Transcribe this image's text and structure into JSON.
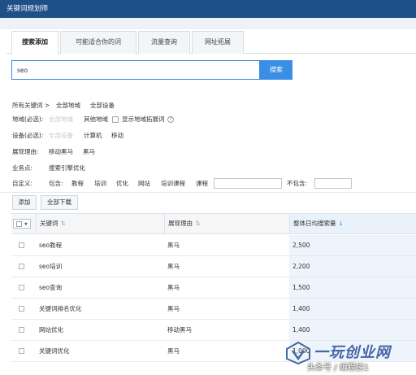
{
  "app": {
    "title": "关键词规划师"
  },
  "tabs": [
    {
      "label": "搜索添加",
      "active": true
    },
    {
      "label": "可能适合你的词",
      "active": false
    },
    {
      "label": "流量查询",
      "active": false
    },
    {
      "label": "网址拓展",
      "active": false
    }
  ],
  "search": {
    "value": "seo",
    "button": "搜索"
  },
  "breadcrumb": {
    "root": "所有关键词 >",
    "region": "全部地域",
    "device": "全部设备"
  },
  "region": {
    "label": "地域(必选):",
    "all": "全部地域",
    "other": "其他地域",
    "show_label": "显示地域拓展词"
  },
  "device": {
    "label": "设备(必选):",
    "all": "全部设备",
    "pc": "计算机",
    "mobile": "移动"
  },
  "reason": {
    "label": "展现理由:",
    "items": [
      "移动黑马",
      "黑马"
    ]
  },
  "business": {
    "label": "业务点:",
    "value": "搜索引擎优化"
  },
  "custom": {
    "label": "自定义:",
    "include_label": "包含:",
    "include_items": [
      "教程",
      "培训",
      "优化",
      "网站",
      "培训课程",
      "课程"
    ],
    "exclude_label": "不包含:"
  },
  "actions": {
    "add": "添加",
    "download_all": "全部下载"
  },
  "table": {
    "headers": {
      "keyword": "关键词",
      "reason": "展现理由",
      "volume": "整体日均搜索量"
    },
    "rows": [
      {
        "keyword": "seo教程",
        "reason": "黑马",
        "volume": "2,500"
      },
      {
        "keyword": "seo培训",
        "reason": "黑马",
        "volume": "2,200"
      },
      {
        "keyword": "seo查询",
        "reason": "黑马",
        "volume": "1,500"
      },
      {
        "keyword": "关键词排名优化",
        "reason": "黑马",
        "volume": "1,400"
      },
      {
        "keyword": "网站优化",
        "reason": "移动黑马",
        "volume": "1,400"
      },
      {
        "keyword": "关键词优化",
        "reason": "黑马",
        "volume": "1,000"
      }
    ]
  },
  "watermark": {
    "text": "一玩创业网",
    "subtitle": "头条号 / 编程侠1"
  }
}
